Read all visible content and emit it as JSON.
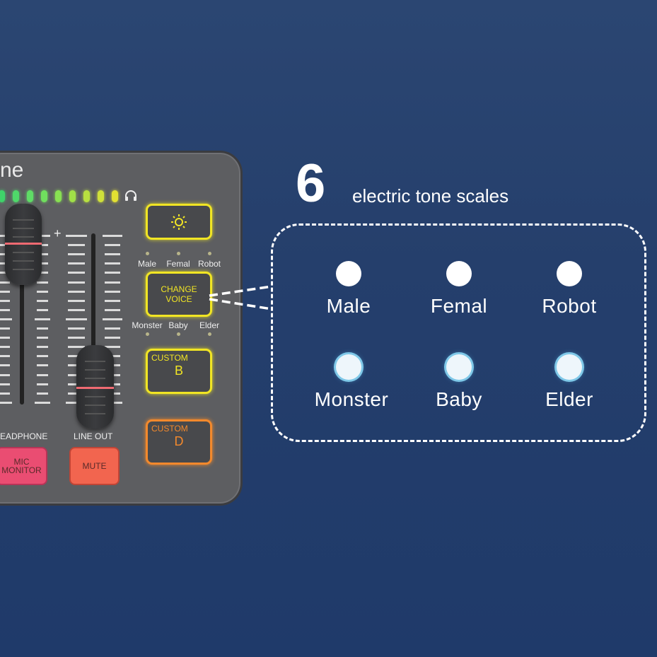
{
  "device": {
    "brand_fragment": "ne",
    "led_colors": [
      "#3fd36a",
      "#4fd86a",
      "#5fdc66",
      "#70df5e",
      "#88e052",
      "#a0e048",
      "#b8e040",
      "#cfe03a",
      "#e2e032"
    ],
    "headphone_icon": "headphones-icon",
    "fader_labels": {
      "headphone": "EADPHONE",
      "line_out": "LINE OUT"
    },
    "plus": "+",
    "buttons": {
      "light": {
        "icon": "sun-icon"
      },
      "change_voice": {
        "line1": "CHANGE",
        "line2": "VOICE"
      },
      "custom_b": {
        "top": "CUSTOM",
        "letter": "B"
      },
      "custom_d": {
        "top": "CUSTOM",
        "letter": "D"
      },
      "mic_monitor": {
        "line1": "MIC",
        "line2": "MONITOR"
      },
      "mute": "MUTE"
    },
    "voice_labels_top": [
      "Male",
      "Femal",
      "Robot"
    ],
    "voice_labels_bottom": [
      "Monster",
      "Baby",
      "Elder"
    ],
    "colors": {
      "yellow": "#f1e524",
      "orange": "#f3892c",
      "pink": "#e94a6f",
      "coral": "#f0604c"
    }
  },
  "headline": {
    "number": "6",
    "text": "electric tone scales"
  },
  "voices": {
    "row1": [
      "Male",
      "Femal",
      "Robot"
    ],
    "row2": [
      "Monster",
      "Baby",
      "Elder"
    ]
  }
}
